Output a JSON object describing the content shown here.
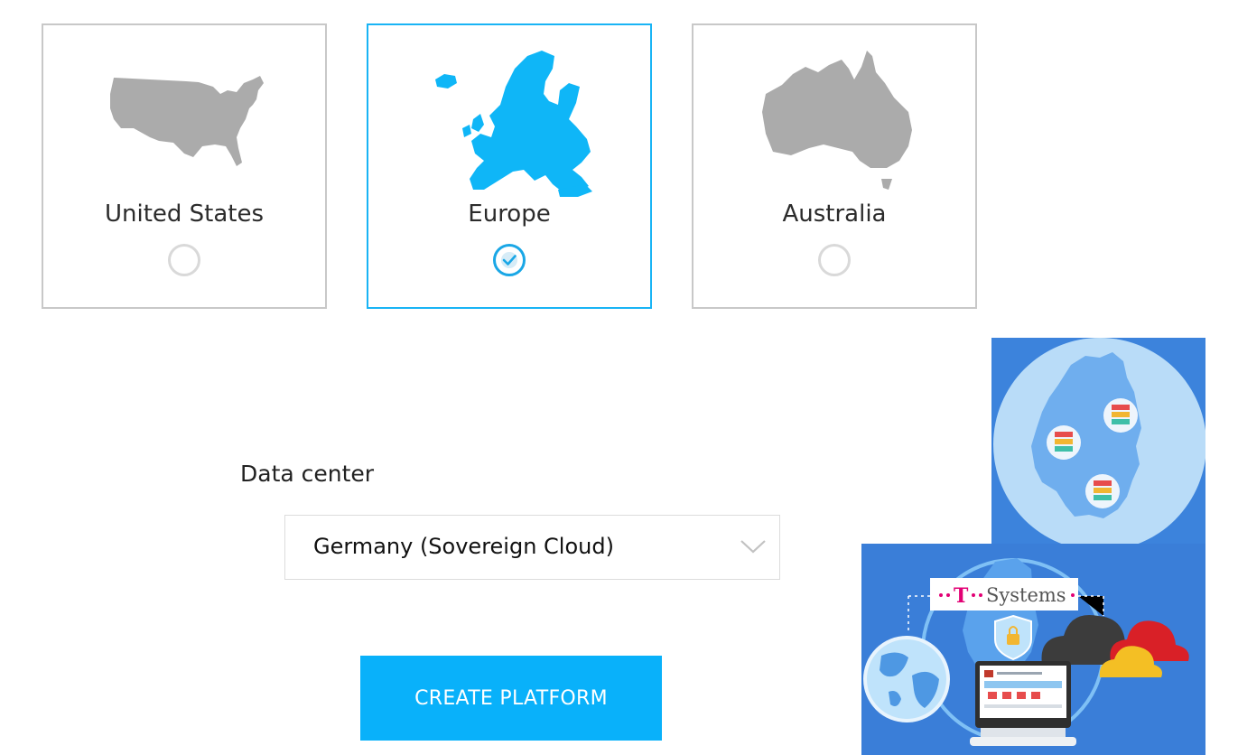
{
  "regions": [
    {
      "name": "United States",
      "selected": false,
      "icon": "us-map-icon"
    },
    {
      "name": "Europe",
      "selected": true,
      "icon": "europe-map-icon"
    },
    {
      "name": "Australia",
      "selected": false,
      "icon": "australia-map-icon"
    }
  ],
  "data_center": {
    "label": "Data center",
    "selected_value": "Germany (Sovereign Cloud)",
    "icon": "chevron-down-icon"
  },
  "create_button": {
    "label": "CREATE PLATFORM"
  },
  "promo": {
    "brand_text": "Systems",
    "brand_mark": "T",
    "icons": [
      "germany-map-icon",
      "server-icon",
      "globe-icon",
      "shield-lock-icon",
      "cloud-icon",
      "monitor-icon"
    ]
  },
  "colors": {
    "accent": "#09b1fa",
    "selected_border": "#19b4f5",
    "map_gray": "#aaaaaa",
    "map_selected": "#0fb6f7",
    "promo_blue": "#3c83dc",
    "telekom_magenta": "#e20074"
  }
}
